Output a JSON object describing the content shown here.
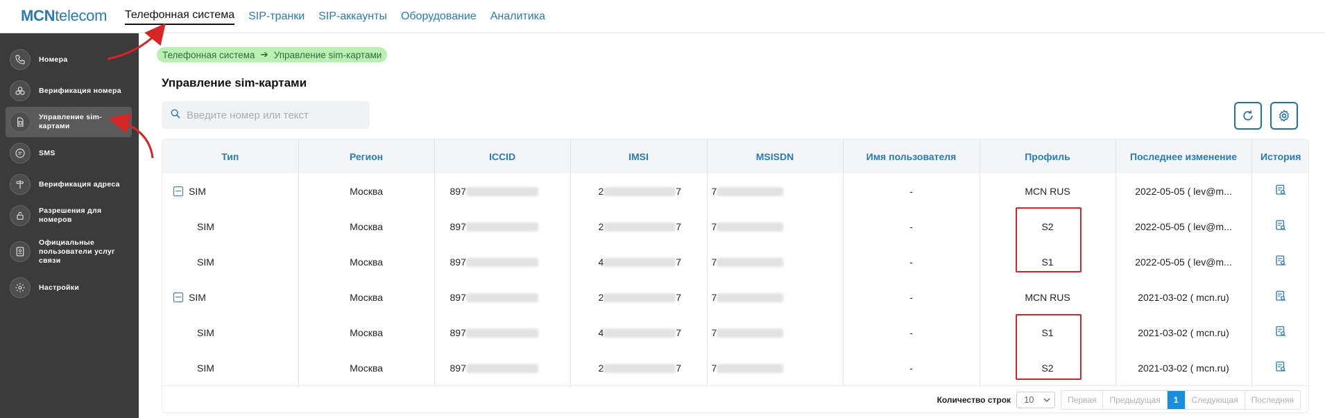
{
  "brand": {
    "logo_bold": "MCN",
    "logo_rest": "telecom"
  },
  "nav": [
    {
      "label": "Телефонная система",
      "active": true
    },
    {
      "label": "SIP-транки"
    },
    {
      "label": "SIP-аккаунты"
    },
    {
      "label": "Оборудование"
    },
    {
      "label": "Аналитика"
    }
  ],
  "sidebar": {
    "items": [
      {
        "label": "Номера",
        "icon": "phone-icon"
      },
      {
        "label": "Верификация номера",
        "icon": "verify-number-icon"
      },
      {
        "label": "Управление sim-картами",
        "icon": "sim-card-icon",
        "active": true
      },
      {
        "label": "SMS",
        "icon": "sms-icon"
      },
      {
        "label": "Верификация адреса",
        "icon": "signpost-icon"
      },
      {
        "label": "Разрешения для номеров",
        "icon": "lock-icon"
      },
      {
        "label": "Официальные пользователи услуг связи",
        "icon": "id-card-icon"
      },
      {
        "label": "Настройки",
        "icon": "gear-icon"
      }
    ]
  },
  "breadcrumb": {
    "parent": "Телефонная система",
    "arrow": "➔",
    "current": "Управление sim-картами"
  },
  "page": {
    "title": "Управление sim-картами"
  },
  "search": {
    "placeholder": "Введите номер или текст"
  },
  "table": {
    "headers": [
      "Тип",
      "Регион",
      "ICCID",
      "IMSI",
      "MSISDN",
      "Имя пользователя",
      "Профиль",
      "Последнее изменение",
      "История"
    ],
    "rows": [
      {
        "type": "SIM",
        "parent": true,
        "region": "Москва",
        "iccid": "897",
        "imsi_start": "2",
        "imsi_end": "7",
        "msisdn": "7",
        "user": "-",
        "profile": "MCN RUS",
        "changed_date": "2022-05-05",
        "changed_who": "(   lev@m..."
      },
      {
        "type": "SIM",
        "parent": false,
        "region": "Москва",
        "iccid": "897",
        "imsi_start": "2",
        "imsi_end": "7",
        "msisdn": "7",
        "user": "-",
        "profile": "S2",
        "changed_date": "2022-05-05",
        "changed_who": "(   lev@m..."
      },
      {
        "type": "SIM",
        "parent": false,
        "region": "Москва",
        "iccid": "897",
        "imsi_start": "4",
        "imsi_end": "7",
        "msisdn": "7",
        "user": "-",
        "profile": "S1",
        "changed_date": "2022-05-05",
        "changed_who": "(   lev@m..."
      },
      {
        "type": "SIM",
        "parent": true,
        "region": "Москва",
        "iccid": "897",
        "imsi_start": "2",
        "imsi_end": "7",
        "msisdn": "7",
        "user": "-",
        "profile": "MCN RUS",
        "changed_date": "2021-03-02",
        "changed_who": "(   mcn.ru)"
      },
      {
        "type": "SIM",
        "parent": false,
        "region": "Москва",
        "iccid": "897",
        "imsi_start": "4",
        "imsi_end": "7",
        "msisdn": "7",
        "user": "-",
        "profile": "S1",
        "changed_date": "2021-03-02",
        "changed_who": "(   mcn.ru)"
      },
      {
        "type": "SIM",
        "parent": false,
        "region": "Москва",
        "iccid": "897",
        "imsi_start": "2",
        "imsi_end": "7",
        "msisdn": "7",
        "user": "-",
        "profile": "S2",
        "changed_date": "2021-03-02",
        "changed_who": "(   mcn.ru)"
      }
    ]
  },
  "footer": {
    "rows_label": "Количество строк",
    "rows_value": "10",
    "pager": {
      "first": "Первая",
      "prev": "Предыдущая",
      "current": "1",
      "next": "Следующая",
      "last": "Последняя"
    }
  },
  "colors": {
    "accent": "#2a7ab8",
    "sidebar": "#3b3b3b",
    "annotation": "#d52525",
    "breadcrumb_bg": "#b9f1b5"
  }
}
